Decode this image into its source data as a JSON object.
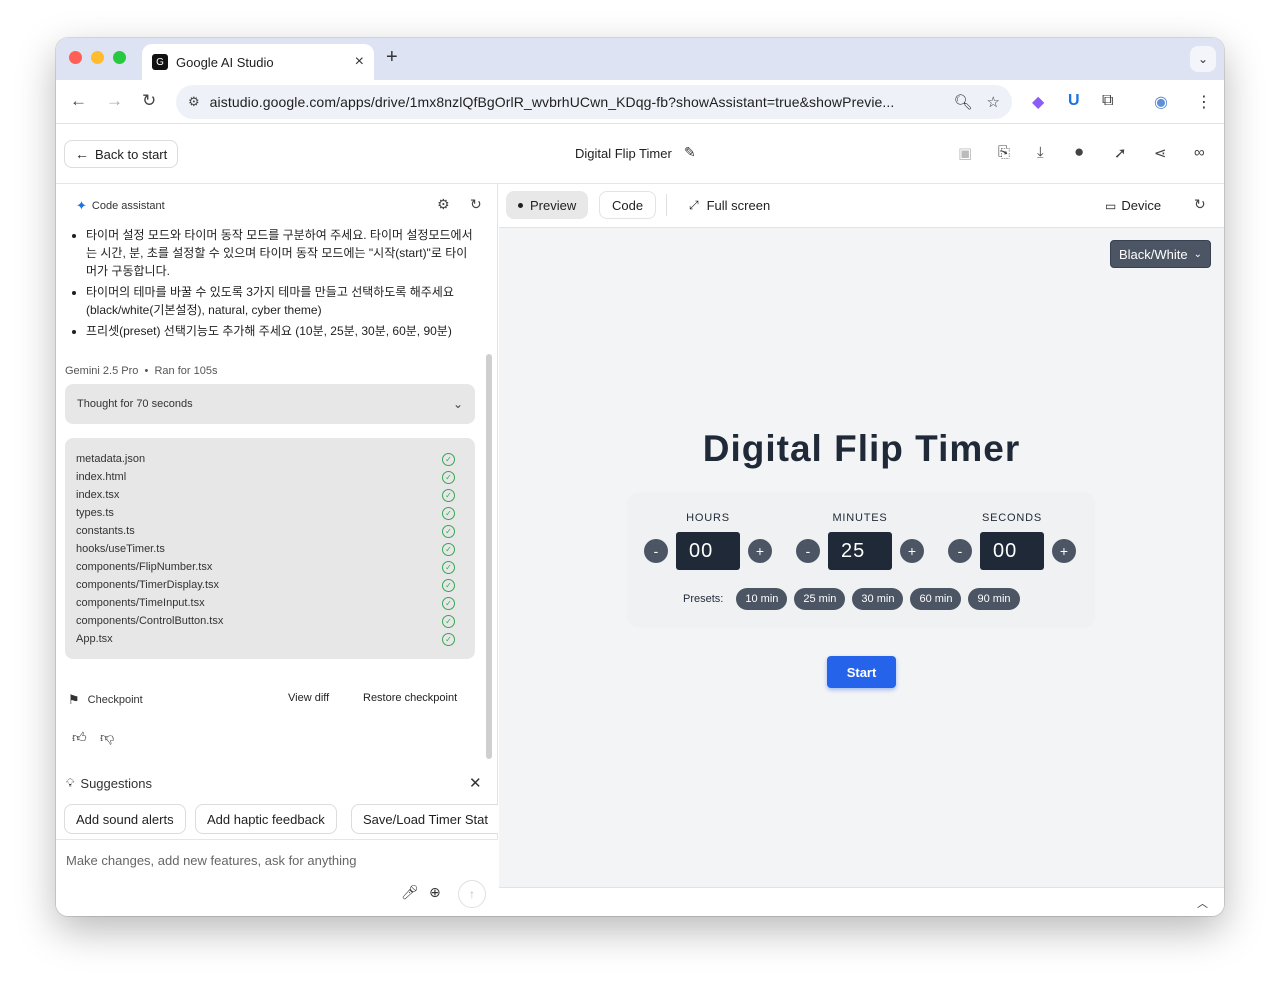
{
  "browser": {
    "tab_title": "Google AI Studio",
    "tab_favicon": "G",
    "tab_close": "×",
    "new_tab": "+",
    "tab_menu": "⌄",
    "url": "aistudio.google.com/apps/drive/1mx8nzlQfBgOrlR_wvbrhUCwn_KDqg-fb?showAssistant=true&showPrevie..."
  },
  "header": {
    "back_label": "Back to start",
    "title": "Digital Flip Timer"
  },
  "assistant": {
    "title": "Code assistant",
    "bullets": [
      "타이머 설정 모드와 타이머 동작 모드를 구분하여 주세요. 타이머 설정모드에서는 시간, 분, 초를 설정할 수 있으며 타이머 동작 모드에는 \"시작(start)\"로 타이머가 구동합니다.",
      "타이머의 테마를 바꿀 수 있도록 3가지 테마를 만들고 선택하도록 해주세요(black/white(기본설정), natural, cyber theme)",
      "프리셋(preset) 선택기능도 추가해 주세요 (10분, 25분, 30분, 60분, 90분)"
    ],
    "model": "Gemini 2.5 Pro",
    "ran_for": "Ran for 105s",
    "thought": "Thought for 70 seconds",
    "files": [
      "metadata.json",
      "index.html",
      "index.tsx",
      "types.ts",
      "constants.ts",
      "hooks/useTimer.ts",
      "components/FlipNumber.tsx",
      "components/TimerDisplay.tsx",
      "components/TimeInput.tsx",
      "components/ControlButton.tsx",
      "App.tsx"
    ],
    "checkpoint": "Checkpoint",
    "view_diff": "View diff",
    "restore": "Restore checkpoint",
    "suggestions_title": "Suggestions",
    "suggestions": [
      "Add sound alerts",
      "Add haptic feedback",
      "Save/Load Timer Stat"
    ],
    "composer_placeholder": "Make changes, add new features, ask for anything"
  },
  "preview": {
    "tabs": [
      "Preview",
      "Code"
    ],
    "full_screen": "Full screen",
    "device": "Device",
    "theme_selected": "Black/White",
    "timer_title": "Digital Flip Timer",
    "units": [
      {
        "label": "HOURS",
        "value": "00"
      },
      {
        "label": "MINUTES",
        "value": "25"
      },
      {
        "label": "SECONDS",
        "value": "00"
      }
    ],
    "minus": "-",
    "plus": "+",
    "presets_label": "Presets:",
    "presets": [
      "10 min",
      "25 min",
      "30 min",
      "60 min",
      "90 min"
    ],
    "start": "Start"
  },
  "colors": {
    "accent": "#2563eb",
    "dark_box": "#1f2937",
    "button_gray": "#4b5563",
    "success": "#34a853"
  }
}
